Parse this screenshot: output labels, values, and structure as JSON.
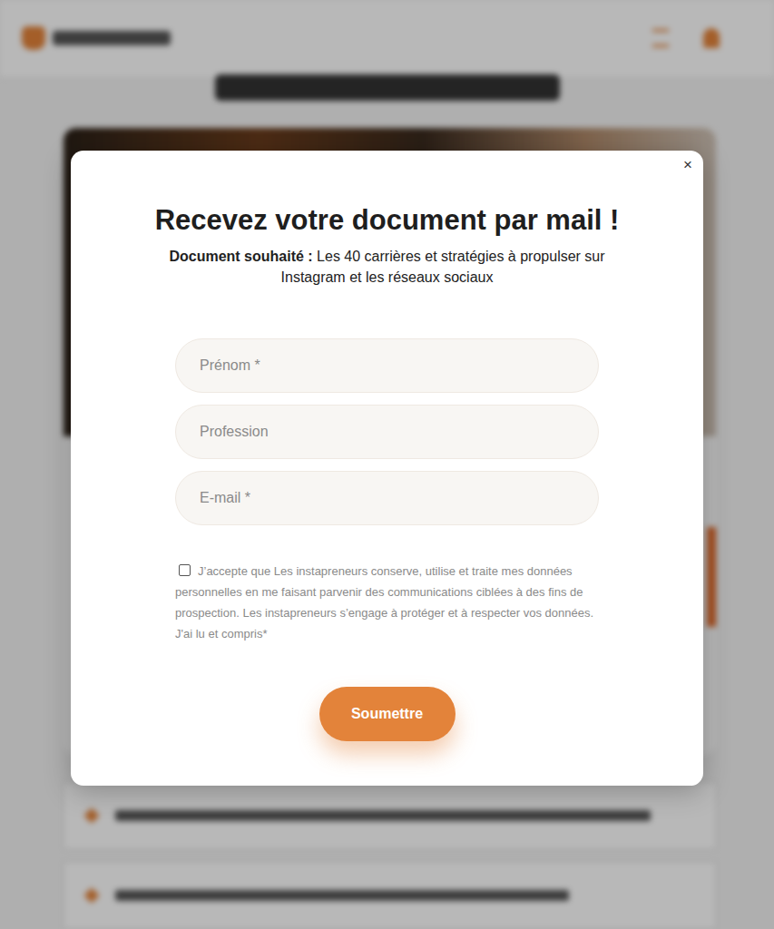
{
  "modal": {
    "close": "×",
    "title": "Recevez votre document par mail !",
    "document_label": "Document souhaité :",
    "document_name": "Les 40 carrières et stratégies à propulser sur Instagram et les réseaux sociaux",
    "fields": [
      {
        "placeholder": "Prénom *"
      },
      {
        "placeholder": "Profession"
      },
      {
        "placeholder": "E-mail *"
      }
    ],
    "consent": {
      "checked": false,
      "text": "J’accepte que Les instapreneurs conserve, utilise et traite mes données personnelles en me faisant parvenir des communications ciblées à des fins de prospection. Les instapreneurs s’engage à protéger et à respecter vos données. J'ai lu et compris*"
    },
    "submit": "Soumettre"
  }
}
